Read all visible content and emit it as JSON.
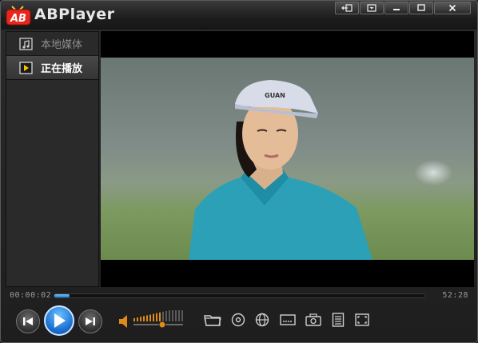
{
  "app": {
    "logo_text": "AB",
    "title": "ABPlayer"
  },
  "window_buttons": [
    "mini-mode-icon",
    "menu-icon",
    "minimize-icon",
    "maximize-icon",
    "close-icon"
  ],
  "sidebar": {
    "items": [
      {
        "label": "本地媒体",
        "icon": "music-file-icon",
        "selected": false
      },
      {
        "label": "正在播放",
        "icon": "play-icon",
        "selected": true
      }
    ]
  },
  "playback": {
    "current_time": "00:00:02",
    "total_time": "52:28",
    "progress_fraction": 0.04,
    "volume_fraction": 0.58
  },
  "video_frame": {
    "cap_text": "GUAN"
  },
  "toolbar": [
    "open-file-icon",
    "disc-icon",
    "globe-icon",
    "subtitle-icon",
    "screenshot-icon",
    "playlist-icon",
    "fullscreen-icon"
  ],
  "colors": {
    "accent": "#2a8ae6",
    "logo_red": "#e8261c",
    "volume_orange": "#e08a1a"
  }
}
